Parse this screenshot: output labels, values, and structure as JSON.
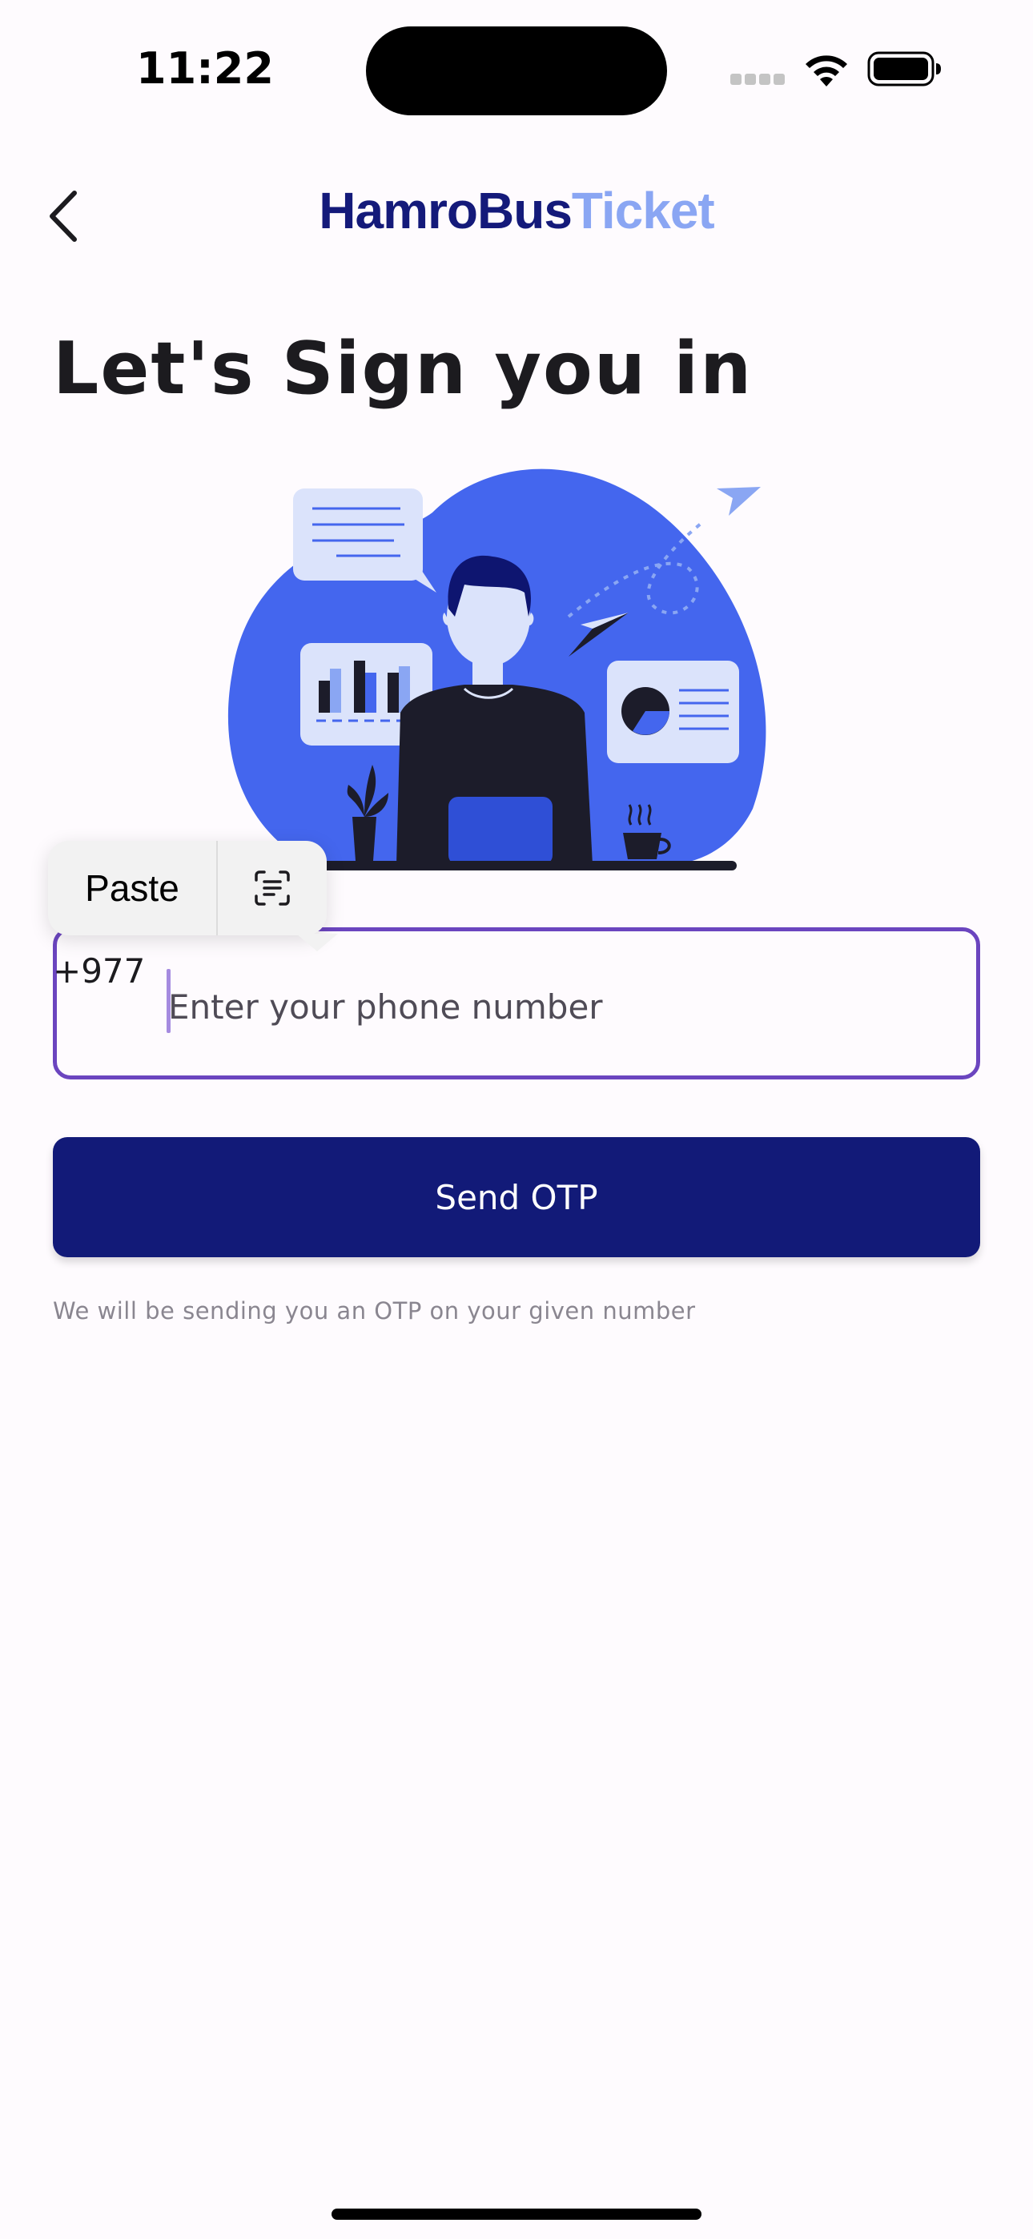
{
  "status_bar": {
    "time": "11:22",
    "icons": [
      "cellular-signal-icon",
      "wifi-icon",
      "battery-icon"
    ]
  },
  "header": {
    "back_icon": "chevron-left-icon",
    "logo_part1": "HamroBus",
    "logo_part2": "Ticket"
  },
  "main": {
    "title": "Let's Sign you in",
    "illustration": "person-at-laptop-illustration",
    "context_menu": {
      "paste_label": "Paste",
      "scan_icon": "scan-text-icon"
    },
    "phone": {
      "country_code": "+977",
      "value": "",
      "placeholder": "Enter your phone number"
    },
    "send_button_label": "Send OTP",
    "helper_text": "We will be sending you an OTP on your given number"
  },
  "colors": {
    "background": "#fefbfe",
    "primary": "#121a78",
    "logo_dark": "#141a7a",
    "logo_light": "#8aa6f3",
    "field_border": "#6b45bf",
    "illustration_blue": "#4466ee"
  }
}
